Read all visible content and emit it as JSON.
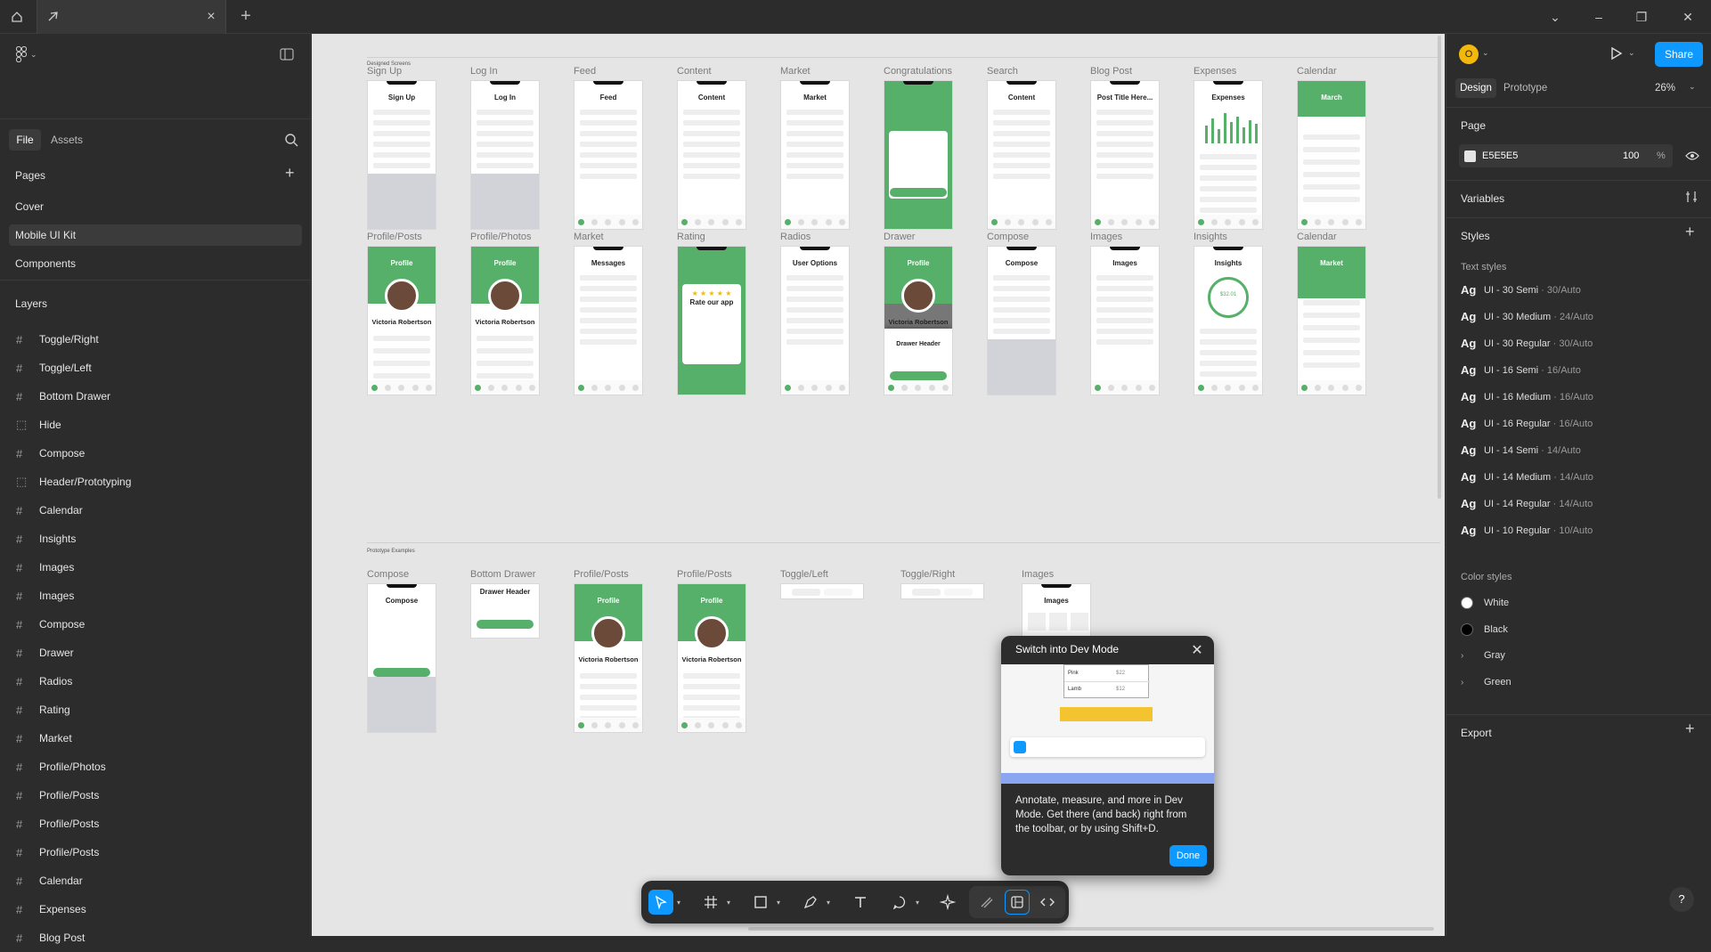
{
  "titlebar": {
    "tab_close": "×",
    "tab_plus": "+",
    "window_controls": {
      "minimize": "–",
      "restore": "❐",
      "close": "✕",
      "dropdown": "⌄"
    }
  },
  "left_panel": {
    "tab_file": "File",
    "tab_assets": "Assets",
    "pages_title": "Pages",
    "pages": [
      {
        "label": "Cover",
        "selected": false
      },
      {
        "label": "Mobile UI Kit",
        "selected": true
      },
      {
        "label": "Components",
        "selected": false
      }
    ],
    "layers_title": "Layers",
    "layers": [
      {
        "label": "Toggle/Right",
        "icon": "#"
      },
      {
        "label": "Toggle/Left",
        "icon": "#"
      },
      {
        "label": "Bottom Drawer",
        "icon": "#"
      },
      {
        "label": "Hide",
        "icon": "⬚"
      },
      {
        "label": "Compose",
        "icon": "#"
      },
      {
        "label": "Header/Prototyping",
        "icon": "⬚"
      },
      {
        "label": "Calendar",
        "icon": "#"
      },
      {
        "label": "Insights",
        "icon": "#"
      },
      {
        "label": "Images",
        "icon": "#"
      },
      {
        "label": "Images",
        "icon": "#"
      },
      {
        "label": "Compose",
        "icon": "#"
      },
      {
        "label": "Drawer",
        "icon": "#"
      },
      {
        "label": "Radios",
        "icon": "#"
      },
      {
        "label": "Rating",
        "icon": "#"
      },
      {
        "label": "Market",
        "icon": "#"
      },
      {
        "label": "Profile/Photos",
        "icon": "#"
      },
      {
        "label": "Profile/Posts",
        "icon": "#"
      },
      {
        "label": "Profile/Posts",
        "icon": "#"
      },
      {
        "label": "Profile/Posts",
        "icon": "#"
      },
      {
        "label": "Calendar",
        "icon": "#"
      },
      {
        "label": "Expenses",
        "icon": "#"
      },
      {
        "label": "Blog Post",
        "icon": "#"
      }
    ]
  },
  "canvas": {
    "section1_label": "Designed Screens",
    "section2_label": "Prototype Examples",
    "row1": [
      {
        "label": "Sign Up",
        "title": "Sign Up",
        "style": "form"
      },
      {
        "label": "Log In",
        "title": "Log In",
        "style": "form"
      },
      {
        "label": "Feed",
        "title": "Feed",
        "style": "list"
      },
      {
        "label": "Content",
        "title": "Content",
        "style": "list"
      },
      {
        "label": "Market",
        "title": "Market",
        "style": "grid"
      },
      {
        "label": "Congratulations",
        "title": "Congratulations!",
        "style": "green"
      },
      {
        "label": "Search",
        "title": "Content",
        "style": "list"
      },
      {
        "label": "Blog Post",
        "title": "Post Title Here...",
        "style": "blog"
      },
      {
        "label": "Expenses",
        "title": "Expenses",
        "style": "chart"
      },
      {
        "label": "Calendar",
        "title": "March",
        "style": "calendar"
      }
    ],
    "row2": [
      {
        "label": "Profile/Posts",
        "title": "Profile",
        "name": "Victoria Robertson",
        "style": "profile"
      },
      {
        "label": "Profile/Photos",
        "title": "Profile",
        "name": "Victoria Robertson",
        "style": "profile"
      },
      {
        "label": "Market",
        "title": "Messages",
        "style": "messages"
      },
      {
        "label": "Rating",
        "title": "Rate our app",
        "stars": "★ ★ ★ ★ ★",
        "style": "rating"
      },
      {
        "label": "Radios",
        "title": "User Options",
        "style": "list"
      },
      {
        "label": "Drawer",
        "title": "Profile",
        "name": "Victoria Robertson",
        "sheet": "Drawer Header",
        "style": "drawer"
      },
      {
        "label": "Compose",
        "title": "Compose",
        "style": "compose"
      },
      {
        "label": "Images",
        "title": "Images",
        "style": "images"
      },
      {
        "label": "Insights",
        "title": "Insights",
        "amount": "$32.01",
        "style": "insights"
      },
      {
        "label": "Calendar",
        "title": "Market",
        "style": "market2"
      }
    ],
    "row3": [
      {
        "label": "Compose",
        "title": "Compose"
      },
      {
        "label": "Bottom Drawer",
        "title": "Drawer Header"
      },
      {
        "label": "Profile/Posts",
        "title": "Profile",
        "name": "Victoria Robertson"
      },
      {
        "label": "Profile/Posts",
        "title": "Profile",
        "name": "Victoria Robertson"
      },
      {
        "label": "Toggle/Left",
        "title": ""
      },
      {
        "label": "Toggle/Right",
        "title": ""
      },
      {
        "label": "Images",
        "title": "Images"
      }
    ]
  },
  "popup": {
    "title": "Switch into Dev Mode",
    "close": "✕",
    "body": "Annotate, measure, and more in Dev Mode. Get there (and back) right from the toolbar, or by using Shift+D.",
    "done": "Done",
    "preview_rows": [
      {
        "name": "Pink",
        "value": "$22"
      },
      {
        "name": "Lamb",
        "value": "$12"
      }
    ]
  },
  "right_panel": {
    "avatar_initial": "O",
    "share": "Share",
    "tab_design": "Design",
    "tab_prototype": "Prototype",
    "zoom": "26%",
    "page_title": "Page",
    "page_color": "E5E5E5",
    "page_opacity": "100",
    "percent": "%",
    "variables": "Variables",
    "styles": "Styles",
    "text_styles_title": "Text styles",
    "text_styles": [
      {
        "name": "UI - 30 Semi",
        "meta": "30/Auto"
      },
      {
        "name": "UI - 30 Medium",
        "meta": "24/Auto"
      },
      {
        "name": "UI - 30 Regular",
        "meta": "30/Auto"
      },
      {
        "name": "UI - 16 Semi",
        "meta": "16/Auto"
      },
      {
        "name": "UI - 16 Medium",
        "meta": "16/Auto"
      },
      {
        "name": "UI - 16 Regular",
        "meta": "16/Auto"
      },
      {
        "name": "UI - 14 Semi",
        "meta": "14/Auto"
      },
      {
        "name": "UI - 14 Medium",
        "meta": "14/Auto"
      },
      {
        "name": "UI - 14 Regular",
        "meta": "14/Auto"
      },
      {
        "name": "UI - 10 Regular",
        "meta": "10/Auto"
      }
    ],
    "color_styles_title": "Color styles",
    "color_styles": [
      {
        "name": "White",
        "color": "#ffffff",
        "group": false
      },
      {
        "name": "Black",
        "color": "#000000",
        "group": false
      },
      {
        "name": "Gray",
        "color": "",
        "group": true
      },
      {
        "name": "Green",
        "color": "",
        "group": true
      }
    ],
    "export": "Export",
    "help": "?"
  },
  "colors": {
    "accent": "#0d99ff",
    "green": "#56b06a",
    "canvas": "#e5e5e5",
    "avatar": "#f2b90c"
  }
}
